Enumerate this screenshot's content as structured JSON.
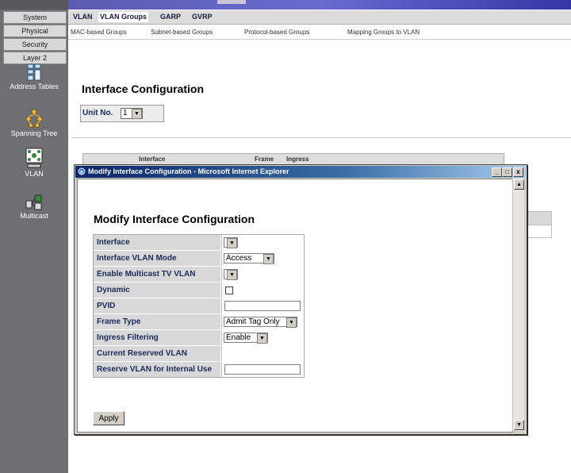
{
  "sidebar": {
    "menu": [
      "System",
      "Physical",
      "Security",
      "Layer 2"
    ],
    "icons": [
      {
        "label": "Address Tables",
        "icon": "address-tables-icon"
      },
      {
        "label": "Spanning Tree",
        "icon": "spanning-tree-icon"
      },
      {
        "label": "VLAN",
        "icon": "vlan-icon"
      },
      {
        "label": "Multicast",
        "icon": "multicast-icon"
      }
    ]
  },
  "tabs": [
    "VLAN",
    "VLAN Groups",
    "GARP",
    "GVRP"
  ],
  "active_tab": "VLAN Groups",
  "subnav": [
    "MAC-based Groups",
    "Subnet-based Groups",
    "Protocol-based Groups",
    "Mapping Groups to VLAN"
  ],
  "main": {
    "title": "Interface Configuration",
    "unit_label": "Unit No.",
    "unit_value": "1",
    "table_headers": [
      "Interface",
      "Frame",
      "Ingress"
    ]
  },
  "dialog": {
    "window_title": "Modify Interface Configuration - Microsoft Internet Explorer",
    "heading": "Modify Interface Configuration",
    "fields": [
      {
        "label": "Interface",
        "type": "select",
        "value": ""
      },
      {
        "label": "Interface VLAN Mode",
        "type": "select",
        "value": "Access"
      },
      {
        "label": "Enable Multicast TV VLAN",
        "type": "select",
        "value": ""
      },
      {
        "label": "Dynamic",
        "type": "checkbox",
        "value": ""
      },
      {
        "label": "PVID",
        "type": "text",
        "value": ""
      },
      {
        "label": "Frame Type",
        "type": "select",
        "value": "Admit Tag Only"
      },
      {
        "label": "Ingress Filtering",
        "type": "select",
        "value": "Enable"
      },
      {
        "label": "Current Reserved VLAN",
        "type": "static",
        "value": ""
      },
      {
        "label": "Reserve VLAN for Internal Use",
        "type": "text",
        "value": ""
      }
    ],
    "apply_label": "Apply",
    "window_buttons": {
      "minimize": "_",
      "maximize": "□",
      "close": "x"
    }
  },
  "colors": {
    "sidebar": "#6f6f72",
    "titlebar_start": "#0a246a",
    "label_bg": "#d8d8d8",
    "label_text": "#1a2a5a"
  }
}
